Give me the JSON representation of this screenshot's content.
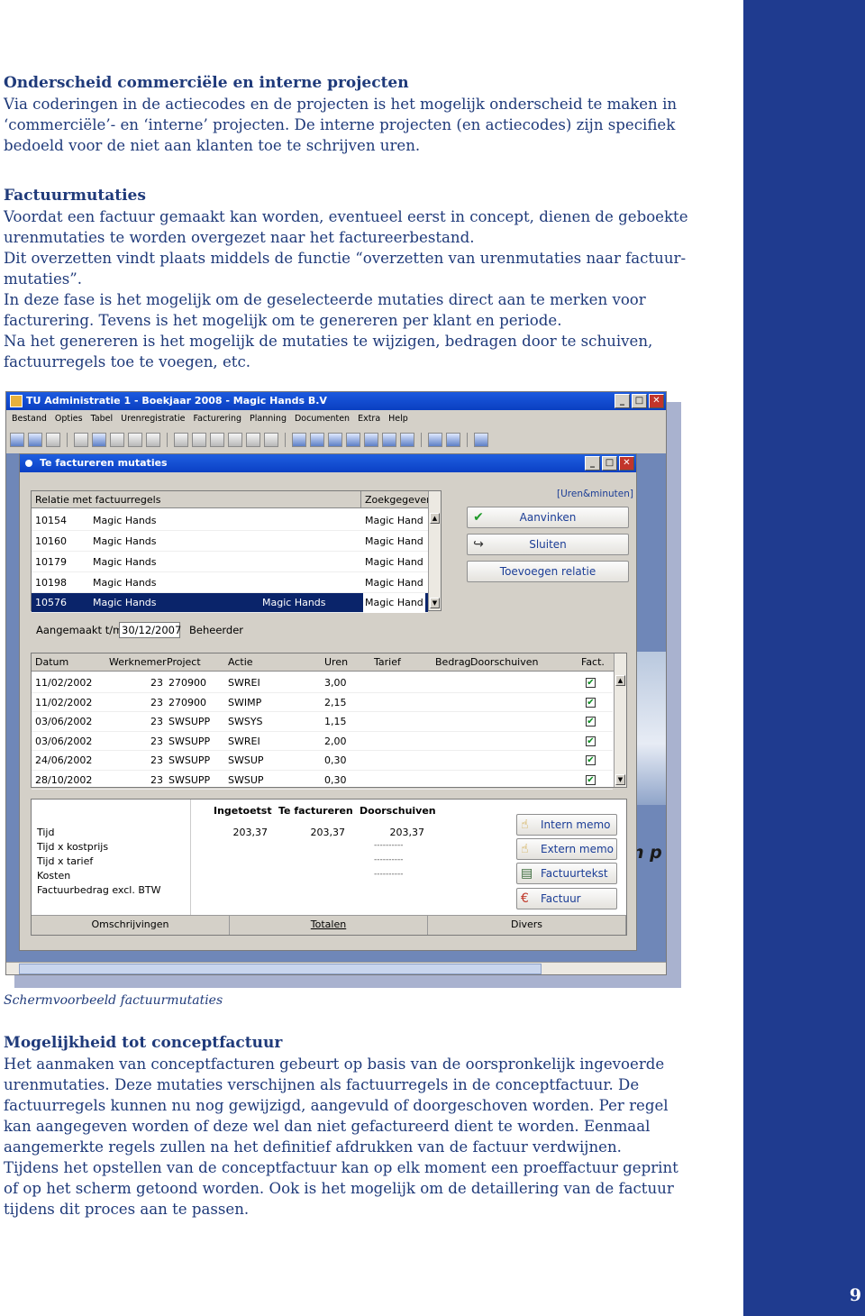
{
  "page_number": "9",
  "section1": {
    "heading": "Onderscheid commerciële en interne projecten",
    "lines": [
      "Via coderingen in de actiecodes en de projecten is het mogelijk onderscheid te maken in",
      "‘commerciële’- en ‘interne’ projecten. De interne projecten (en actiecodes) zijn specifiek",
      "bedoeld voor de niet aan klanten toe te schrijven uren."
    ]
  },
  "section2": {
    "heading": "Factuurmutaties",
    "lines": [
      "Voordat een factuur gemaakt kan worden, eventueel eerst in concept, dienen de geboekte",
      "urenmutaties te worden overgezet naar het factureerbestand.",
      "Dit overzetten vindt plaats middels de functie “overzetten van urenmutaties naar factuur-",
      "mutaties”.",
      "In deze fase is het mogelijk om de geselecteerde mutaties direct aan te merken voor",
      "facturering. Tevens is het mogelijk om te genereren per klant en periode.",
      "Na het genereren is het mogelijk de mutaties te wijzigen, bedragen door te schuiven,",
      "factuurregels toe te voegen, etc."
    ]
  },
  "caption": "Schermvoorbeeld factuurmutaties",
  "section3": {
    "heading": "Mogelijkheid tot conceptfactuur",
    "lines": [
      "Het aanmaken van conceptfacturen gebeurt op basis van de oorspronkelijk ingevoerde",
      "urenmutaties. Deze mutaties verschijnen als factuurregels in de conceptfactuur. De",
      "factuurregels kunnen nu nog gewijzigd, aangevuld of doorgeschoven worden. Per regel",
      "kan aangegeven worden of  deze wel dan niet gefactureerd dient te worden. Eenmaal",
      "aangemerkte regels zullen na het definitief afdrukken van de factuur verdwijnen.",
      "Tijdens het opstellen van de conceptfactuur kan op elk moment een proeffactuur geprint",
      "of op het scherm getoond worden. Ook is het mogelijk om de detaillering van de factuur",
      "tijdens dit proces aan te passen."
    ]
  },
  "screenshot": {
    "window_title": "TU Administratie 1 - Boekjaar 2008 - Magic Hands B.V",
    "menu": [
      "Bestand",
      "Opties",
      "Tabel",
      "Urenregistratie",
      "Facturering",
      "Planning",
      "Documenten",
      "Extra",
      "Help"
    ],
    "background_text": "n p",
    "child_title": "Te factureren mutaties",
    "relation_grid": {
      "headers": [
        "Relatie met factuurregels",
        "Zoekgegeven"
      ],
      "rows": [
        {
          "code": "10154",
          "name": "Magic Hands",
          "extra": "",
          "search": "Magic Hand"
        },
        {
          "code": "10160",
          "name": "Magic Hands",
          "extra": "",
          "search": "Magic Hand"
        },
        {
          "code": "10179",
          "name": "Magic Hands",
          "extra": "",
          "search": "Magic Hand"
        },
        {
          "code": "10198",
          "name": "Magic Hands",
          "extra": "",
          "search": "Magic Hand"
        },
        {
          "code": "10576",
          "name": "Magic Hands",
          "extra": "Magic Hands",
          "search": "Magic Hand"
        }
      ]
    },
    "unit_label": "[Uren&minuten]",
    "buttons": {
      "aanvinken": "Aanvinken",
      "sluiten": "Sluiten",
      "toevoegen": "Toevoegen relatie"
    },
    "created_label": "Aangemaakt t/m",
    "created_value": "30/12/2007",
    "manager_label": "Beheerder",
    "mutation_grid": {
      "headers": [
        "Datum",
        "Werknemer",
        "Project",
        "Actie",
        "Uren",
        "Tarief",
        "Bedrag",
        "Doorschuiven",
        "Fact."
      ],
      "rows": [
        {
          "datum": "11/02/2002",
          "werknemer": "23",
          "project": "270900",
          "actie": "SWREI",
          "uren": "3,00"
        },
        {
          "datum": "11/02/2002",
          "werknemer": "23",
          "project": "270900",
          "actie": "SWIMP",
          "uren": "2,15"
        },
        {
          "datum": "03/06/2002",
          "werknemer": "23",
          "project": "SWSUPP",
          "actie": "SWSYS",
          "uren": "1,15"
        },
        {
          "datum": "03/06/2002",
          "werknemer": "23",
          "project": "SWSUPP",
          "actie": "SWREI",
          "uren": "2,00"
        },
        {
          "datum": "24/06/2002",
          "werknemer": "23",
          "project": "SWSUPP",
          "actie": "SWSUP",
          "uren": "0,30"
        },
        {
          "datum": "28/10/2002",
          "werknemer": "23",
          "project": "SWSUPP",
          "actie": "SWSUP",
          "uren": "0,30"
        }
      ]
    },
    "totals": {
      "headers": [
        "Ingetoetst",
        "Te factureren",
        "Doorschuiven"
      ],
      "labels": [
        "Tijd",
        "Tijd x kostprijs",
        "Tijd x tarief",
        "Kosten",
        "Factuurbedrag excl. BTW"
      ],
      "tijd": [
        "203,37",
        "203,37",
        "203,37"
      ],
      "dashes": "----------"
    },
    "tabs": [
      "Omschrijvingen",
      "Totalen",
      "Divers"
    ],
    "side_buttons": [
      "Intern memo",
      "Extern memo",
      "Factuurtekst",
      "Factuur"
    ]
  }
}
